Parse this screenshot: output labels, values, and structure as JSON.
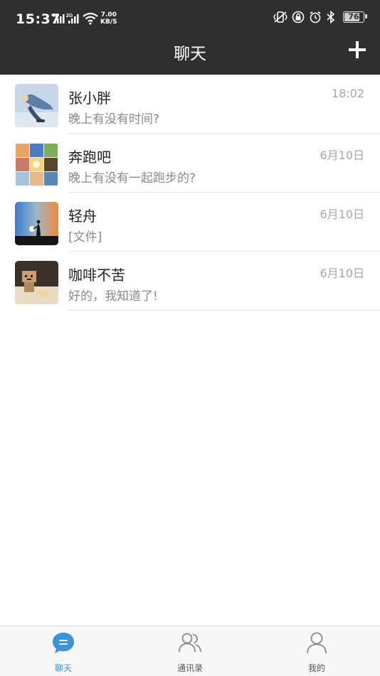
{
  "status_bar": {
    "time": "15:37",
    "net_line1": "4G",
    "net_line2": "2G",
    "speed_value": "7.00",
    "speed_unit": "KB/S",
    "battery": "76",
    "battery_level": 0.76,
    "icons": [
      "vibrate-icon",
      "sync-lock-icon",
      "alarm-icon",
      "bluetooth-icon"
    ]
  },
  "header": {
    "title": "聊天",
    "add_icon": "plus-icon"
  },
  "chats": [
    {
      "name": "张小胖",
      "preview": "晚上有没有时间?",
      "time": "18:02",
      "avatar": "avatar-person-sitting"
    },
    {
      "name": "奔跑吧",
      "preview": "晚上有没有一起跑步的?",
      "time": "6月10日",
      "avatar": "avatar-group-grid"
    },
    {
      "name": "轻舟",
      "preview": "[文件]",
      "time": "6月10日",
      "avatar": "avatar-sunset-silhouette"
    },
    {
      "name": "咖啡不苦",
      "preview": "好的，我知道了!",
      "time": "6月10日",
      "avatar": "avatar-cardboard-robot"
    }
  ],
  "tabs": [
    {
      "label": "聊天",
      "icon": "chat-bubble-icon",
      "active": true
    },
    {
      "label": "通讯录",
      "icon": "contacts-icon",
      "active": false
    },
    {
      "label": "我的",
      "icon": "profile-icon",
      "active": false
    }
  ],
  "colors": {
    "header_bg": "#2f2f2f",
    "accent": "#3b94d6",
    "tab_inactive": "#555555"
  }
}
